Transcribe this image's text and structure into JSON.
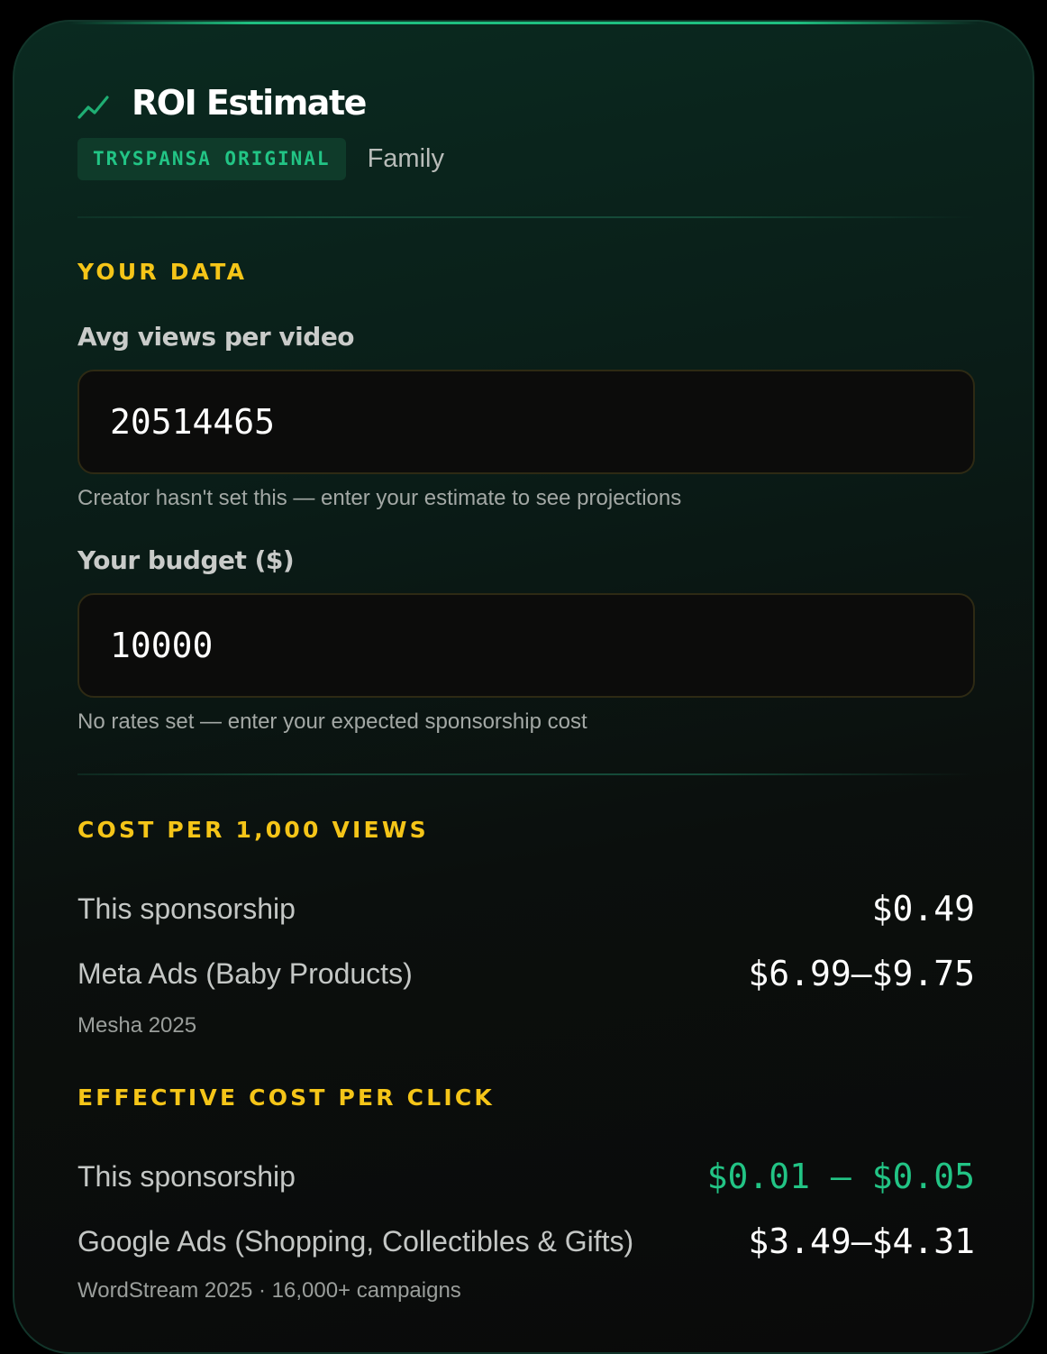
{
  "header": {
    "title": "ROI Estimate",
    "badge": "TRYSPANSA ORIGINAL",
    "category": "Family"
  },
  "your_data": {
    "heading": "YOUR DATA",
    "views": {
      "label": "Avg views per video",
      "value": "20514465",
      "hint": "Creator hasn't set this — enter your estimate to see projections"
    },
    "budget": {
      "label": "Your budget ($)",
      "value": "10000",
      "hint": "No rates set — enter your expected sponsorship cost"
    }
  },
  "cpm": {
    "heading": "COST PER 1,000 VIEWS",
    "sponsorship_label": "This sponsorship",
    "sponsorship_value": "$0.49",
    "benchmark_label": "Meta Ads (Baby Products)",
    "benchmark_value": "$6.99–$9.75",
    "source": "Mesha 2025"
  },
  "cpc": {
    "heading": "EFFECTIVE COST PER CLICK",
    "sponsorship_label": "This sponsorship",
    "sponsorship_value": "$0.01 – $0.05",
    "benchmark_label": "Google Ads (Shopping, Collectibles & Gifts)",
    "benchmark_value": "$3.49–$4.31",
    "source": "WordStream 2025 · 16,000+ campaigns"
  },
  "colors": {
    "accent_green": "#22c485",
    "section_yellow": "#f5c518",
    "background": "#0a0a0a"
  },
  "icons": {
    "title_icon": "trending-up-icon"
  }
}
